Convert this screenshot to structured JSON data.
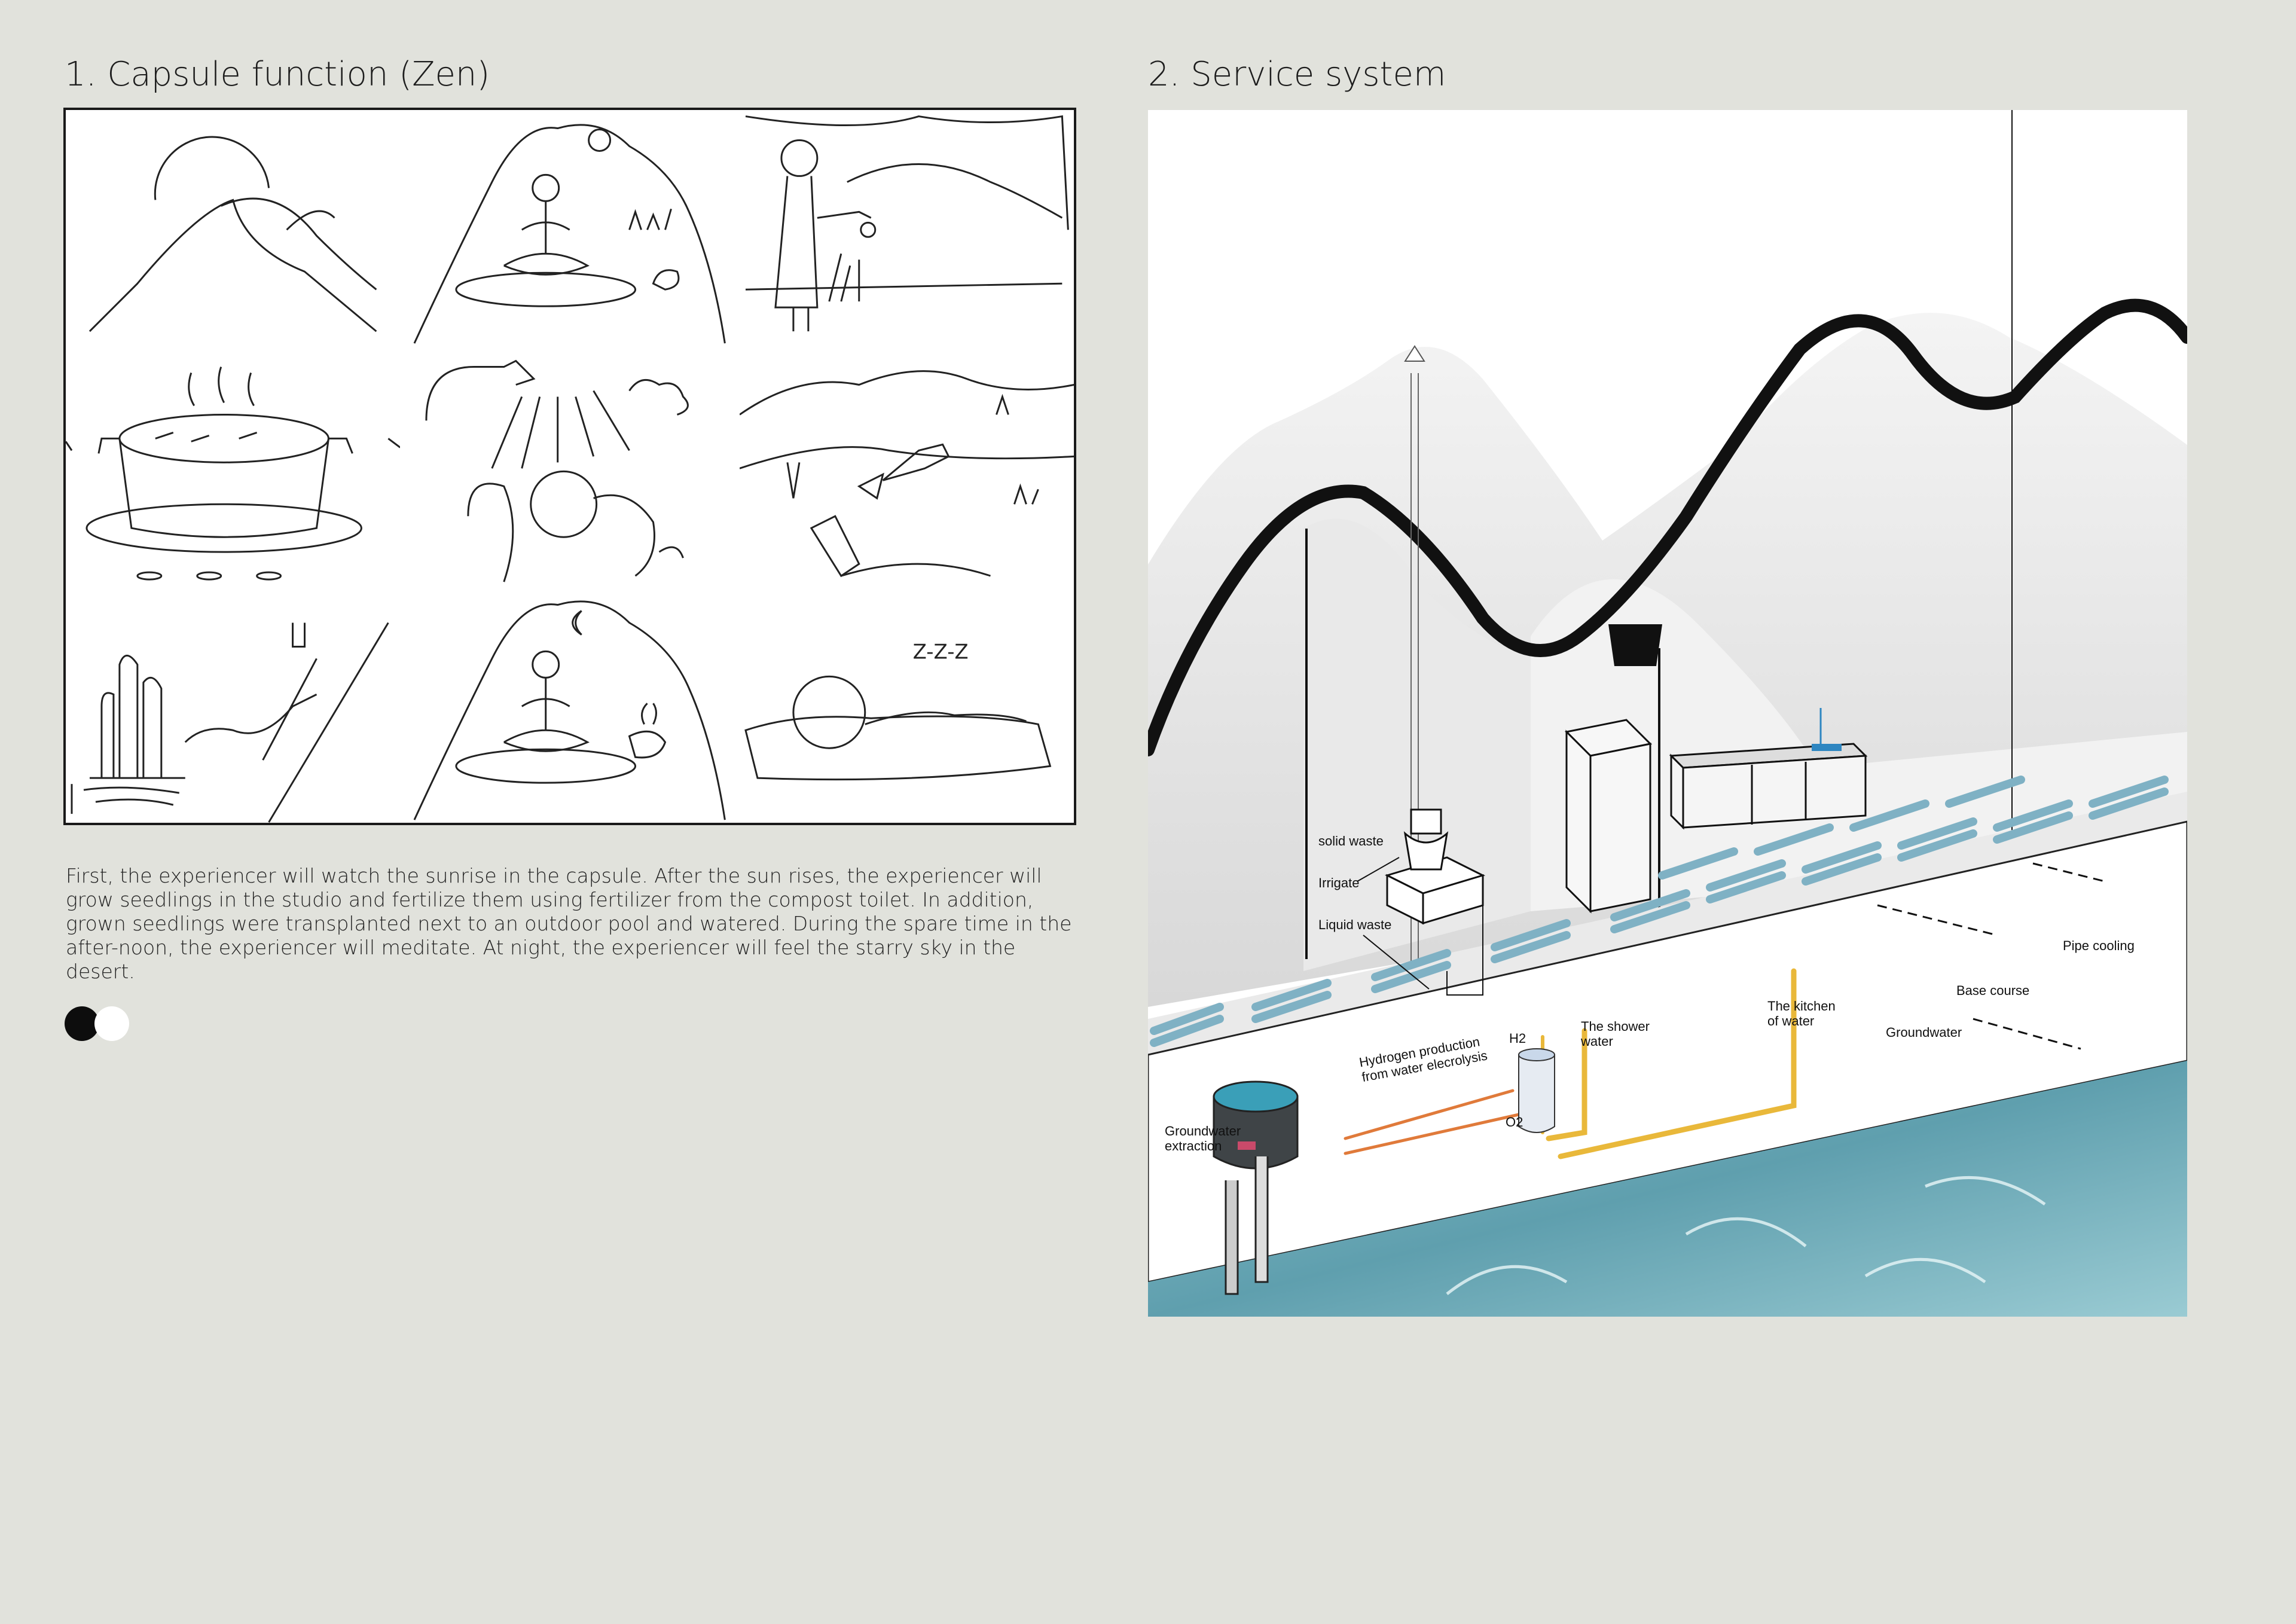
{
  "left": {
    "heading": "1. Capsule function (Zen)",
    "description": "First, the experiencer will watch the sunrise in the capsule. After the sun rises, the experiencer will grow seedlings in the studio and fertilize them using fertilizer from the compost toilet. In addition, grown seedlings were transplanted next to an outdoor pool and watered. During the spare time in the after-noon, the experiencer will meditate. At night, the experiencer will feel the starry sky in the desert.",
    "storyboard_icons": [
      "sunrise-icon",
      "meditation-icon",
      "watering-icon",
      "cooking-pot-icon",
      "shower-icon",
      "planting-icon",
      "cactus-hose-icon",
      "night-meditation-icon",
      "sleeping-icon"
    ],
    "sleep_text": "Z-Z-Z",
    "pager": {
      "pages": 2,
      "active": 1
    }
  },
  "right": {
    "heading": "2. Service system",
    "labels": {
      "solid_waste": "solid waste",
      "irrigate": "Irrigate",
      "liquid_waste": "Liquid waste",
      "pipe_cooling": "Pipe cooling",
      "base_course": "Base course",
      "groundwater": "Groundwater",
      "kitchen_water": [
        "The kitchen",
        "of water"
      ],
      "shower_water": [
        "The shower",
        "water"
      ],
      "h2": "H2",
      "o2": "O2",
      "hydrogen": [
        "Hydrogen production",
        "from water elecrolysis"
      ],
      "groundwater_extraction": [
        "Groundwater",
        "extraction"
      ]
    },
    "colors": {
      "pipe_yellow": "#e9b83a",
      "pipe_orange": "#e07a3a",
      "water": "#7fb6c2",
      "tank": "#3f4447"
    }
  }
}
